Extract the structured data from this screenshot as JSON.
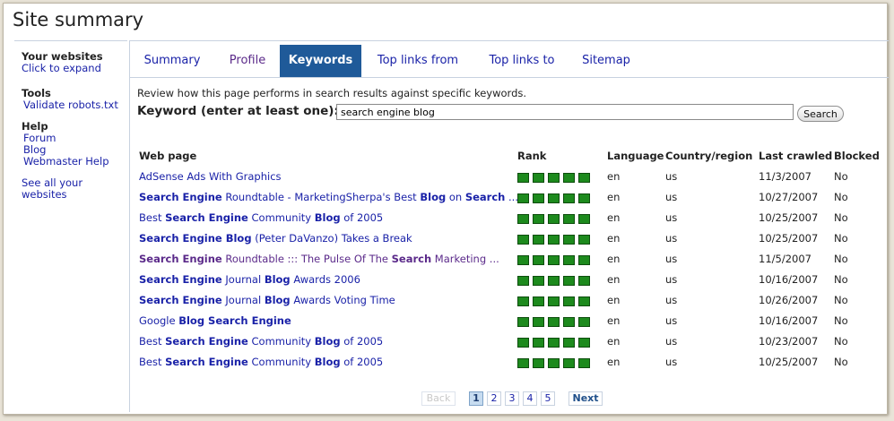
{
  "page_title": "Site summary",
  "sidebar": {
    "your_websites": {
      "heading": "Your websites",
      "link": "Click to expand"
    },
    "tools": {
      "heading": "Tools",
      "links": [
        "Validate robots.txt"
      ]
    },
    "help": {
      "heading": "Help",
      "links": [
        "Forum",
        "Blog",
        "Webmaster Help"
      ]
    },
    "see_all": [
      "See all your",
      "websites"
    ]
  },
  "tabs": [
    "Summary",
    "Profile",
    "Keywords",
    "Top links from",
    "Top links to",
    "Sitemap"
  ],
  "active_tab": "Keywords",
  "description": "Review how this page performs in search results against specific keywords.",
  "keyword": {
    "label": "Keyword (enter at least one):",
    "value": "search engine blog",
    "button": "Search"
  },
  "table": {
    "headers": {
      "page": "Web page",
      "rank": "Rank",
      "language": "Language",
      "country": "Country/region",
      "crawled": "Last crawled",
      "blocked": "Blocked"
    },
    "rows": [
      {
        "page": "AdSense Ads With Graphics",
        "rank_bars": 5,
        "language": "en",
        "country": "us",
        "crawled": "11/3/2007",
        "blocked": "No"
      },
      {
        "page": "Search Engine Roundtable - MarketingSherpa's Best Blog on Search ...",
        "rank_bars": 5,
        "language": "en",
        "country": "us",
        "crawled": "10/27/2007",
        "blocked": "No"
      },
      {
        "page": "Best Search Engine Community Blog of 2005",
        "rank_bars": 5,
        "language": "en",
        "country": "us",
        "crawled": "10/25/2007",
        "blocked": "No"
      },
      {
        "page": "Search Engine Blog (Peter DaVanzo) Takes a Break",
        "rank_bars": 5,
        "language": "en",
        "country": "us",
        "crawled": "10/25/2007",
        "blocked": "No"
      },
      {
        "page": "Search Engine Roundtable ::: The Pulse Of The Search Marketing ...",
        "rank_bars": 5,
        "language": "en",
        "country": "us",
        "crawled": "11/5/2007",
        "blocked": "No"
      },
      {
        "page": "Search Engine Journal Blog Awards 2006",
        "rank_bars": 5,
        "language": "en",
        "country": "us",
        "crawled": "10/16/2007",
        "blocked": "No"
      },
      {
        "page": "Search Engine Journal Blog Awards Voting Time",
        "rank_bars": 5,
        "language": "en",
        "country": "us",
        "crawled": "10/26/2007",
        "blocked": "No"
      },
      {
        "page": "Google Blog Search Engine",
        "rank_bars": 5,
        "language": "en",
        "country": "us",
        "crawled": "10/16/2007",
        "blocked": "No"
      },
      {
        "page": "Best Search Engine Community Blog of 2005",
        "rank_bars": 5,
        "language": "en",
        "country": "us",
        "crawled": "10/23/2007",
        "blocked": "No"
      },
      {
        "page": "Best Search Engine Community Blog of 2005",
        "rank_bars": 5,
        "language": "en",
        "country": "us",
        "crawled": "10/25/2007",
        "blocked": "No"
      }
    ]
  },
  "pagination": {
    "back": "Back",
    "pages": [
      "1",
      "2",
      "3",
      "4",
      "5"
    ],
    "current": "1",
    "next": "Next"
  },
  "colors": {
    "link": "#1a22a8",
    "visited_link": "#5b2a8a",
    "active_tab_bg": "#1f5a99",
    "rank_bar": "#1d8a1d"
  }
}
